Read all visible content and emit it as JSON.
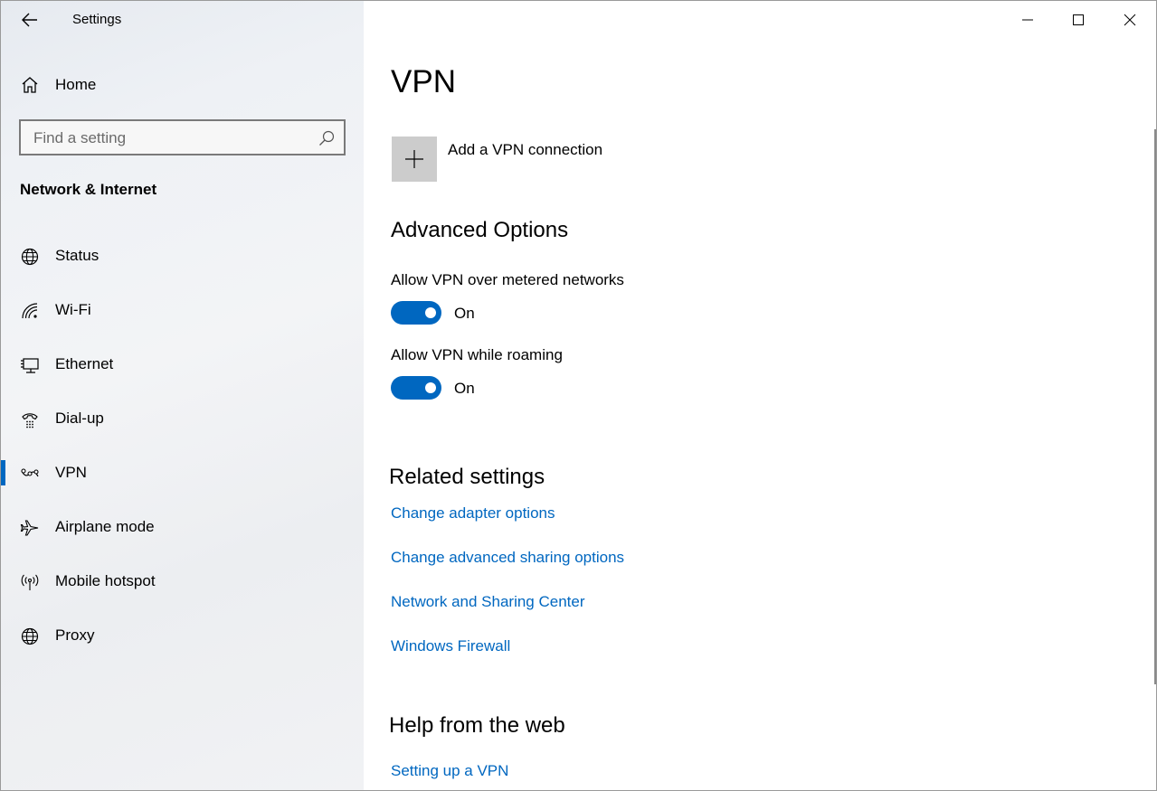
{
  "window": {
    "app_title": "Settings",
    "controls": {
      "minimize": "minimize",
      "maximize": "maximize",
      "close": "close"
    }
  },
  "sidebar": {
    "home_label": "Home",
    "search": {
      "placeholder": "Find a setting",
      "value": ""
    },
    "section_title": "Network & Internet",
    "items": [
      {
        "label": "Status",
        "icon": "globe-status-icon"
      },
      {
        "label": "Wi-Fi",
        "icon": "wifi-icon"
      },
      {
        "label": "Ethernet",
        "icon": "ethernet-icon"
      },
      {
        "label": "Dial-up",
        "icon": "dialup-icon"
      },
      {
        "label": "VPN",
        "icon": "vpn-icon",
        "selected": true
      },
      {
        "label": "Airplane mode",
        "icon": "airplane-icon"
      },
      {
        "label": "Mobile hotspot",
        "icon": "hotspot-icon"
      },
      {
        "label": "Proxy",
        "icon": "globe-icon"
      }
    ]
  },
  "main": {
    "title": "VPN",
    "add_vpn_label": "Add a VPN connection",
    "advanced": {
      "heading": "Advanced Options",
      "options": [
        {
          "label": "Allow VPN over metered networks",
          "state": "On",
          "enabled": true
        },
        {
          "label": "Allow VPN while roaming",
          "state": "On",
          "enabled": true
        }
      ]
    },
    "related": {
      "heading": "Related settings",
      "links": [
        "Change adapter options",
        "Change advanced sharing options",
        "Network and Sharing Center",
        "Windows Firewall"
      ]
    },
    "help": {
      "heading": "Help from the web",
      "links": [
        "Setting up a VPN"
      ]
    }
  },
  "colors": {
    "accent": "#0067c0",
    "link": "#0067c0",
    "sidebar_bg": "#eef1f5"
  }
}
